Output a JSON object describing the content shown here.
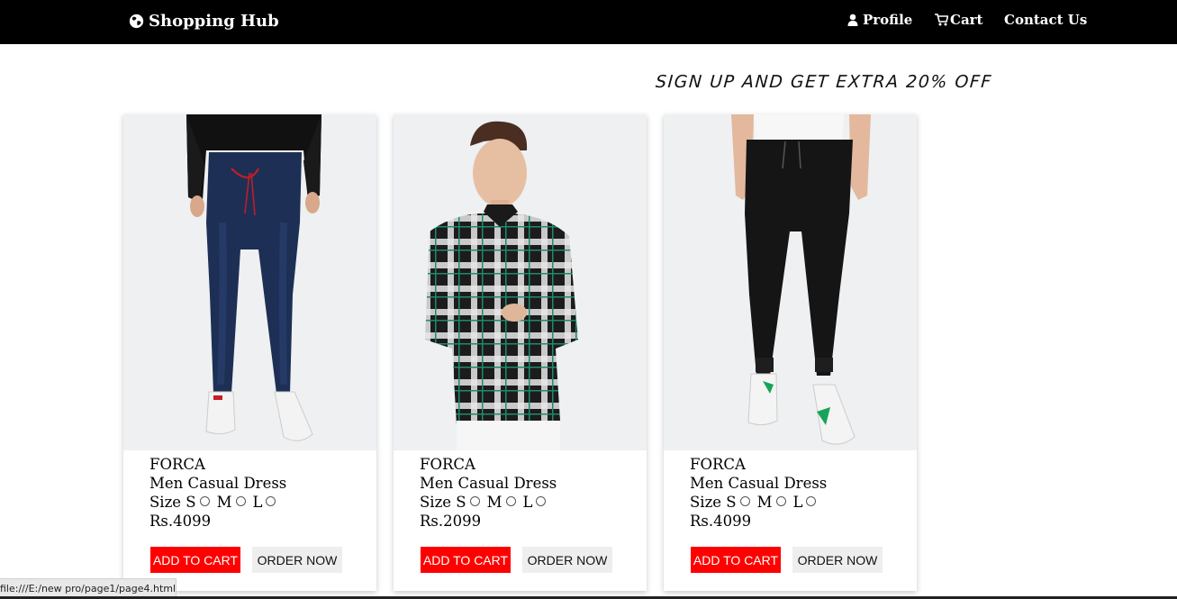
{
  "navbar": {
    "brand": "Shopping Hub",
    "brand_icon": "globe-icon",
    "links": [
      {
        "label": "Profile",
        "icon": "user-icon"
      },
      {
        "label": "Cart",
        "icon": "cart-icon"
      },
      {
        "label": "Contact Us",
        "icon": ""
      }
    ]
  },
  "promo": "SIGN UP AND GET EXTRA 20% OFF",
  "products": [
    {
      "brand": "FORCA",
      "name": "Men Casual Dress",
      "size_label": "Size",
      "sizes": [
        "S",
        "M",
        "L"
      ],
      "price": "Rs.4099",
      "image": "blue-jeans",
      "add_to_cart": "ADD TO CART",
      "order_now": "ORDER NOW"
    },
    {
      "brand": "FORCA",
      "name": "Men Casual Dress",
      "size_label": "Size",
      "sizes": [
        "S",
        "M",
        "L"
      ],
      "price": "Rs.2099",
      "image": "checked-shirt",
      "add_to_cart": "ADD TO CART",
      "order_now": "ORDER NOW"
    },
    {
      "brand": "FORCA",
      "name": "Men Casual Dress",
      "size_label": "Size",
      "sizes": [
        "S",
        "M",
        "L"
      ],
      "price": "Rs.4099",
      "image": "black-joggers",
      "add_to_cart": "ADD TO CART",
      "order_now": "ORDER NOW"
    }
  ],
  "status_bar": "file:///E:/new pro/page1/page4.html",
  "colors": {
    "navbar_bg": "#000000",
    "add_to_cart_bg": "#ff0000",
    "order_now_bg": "#eeeeee"
  }
}
